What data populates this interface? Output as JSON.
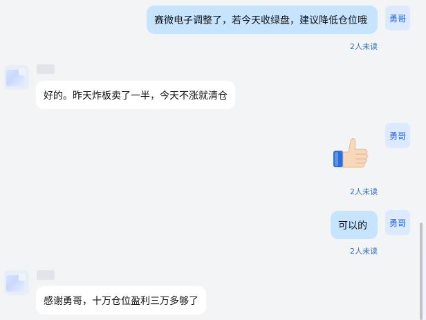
{
  "me": {
    "avatar_label": "勇哥"
  },
  "read_status": "2人未读",
  "messages": [
    {
      "text": "赛微电子调整了，若今天收绿盘，建议降低仓位哦"
    },
    {
      "text": "好的。昨天炸板卖了一半，今天不涨就清仓"
    },
    {
      "emoji": "thumbs-up"
    },
    {
      "text": "可以的"
    },
    {
      "text": "感谢勇哥，十万仓位盈利三万多够了"
    }
  ],
  "colors": {
    "background": "#f3f4f6",
    "my_bubble": "#c7e4ff",
    "other_bubble": "#ffffff",
    "read_status": "#2f6fbf",
    "my_avatar_bg": "#dbeafe"
  }
}
